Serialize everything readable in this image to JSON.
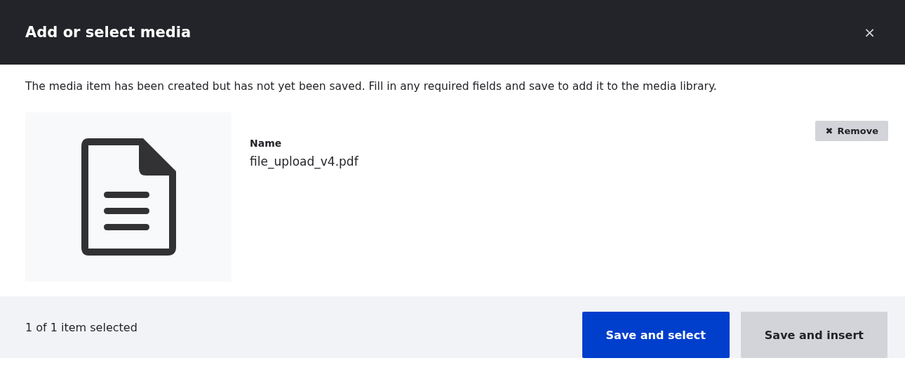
{
  "dialog": {
    "title": "Add or select media",
    "close": "×"
  },
  "message": "The media item has been created but has not yet been saved. Fill in any required fields and save to add it to the media library.",
  "media_item": {
    "remove_button": {
      "icon": "✖",
      "label": "Remove"
    },
    "fields": [
      {
        "label": "Name",
        "value": "file_upload_v4.pdf"
      }
    ]
  },
  "footer": {
    "status": "1 of 1 item selected",
    "buttons": [
      {
        "label": "Save and select",
        "kind": "primary"
      },
      {
        "label": "Save and insert",
        "kind": "secondary"
      }
    ]
  }
}
